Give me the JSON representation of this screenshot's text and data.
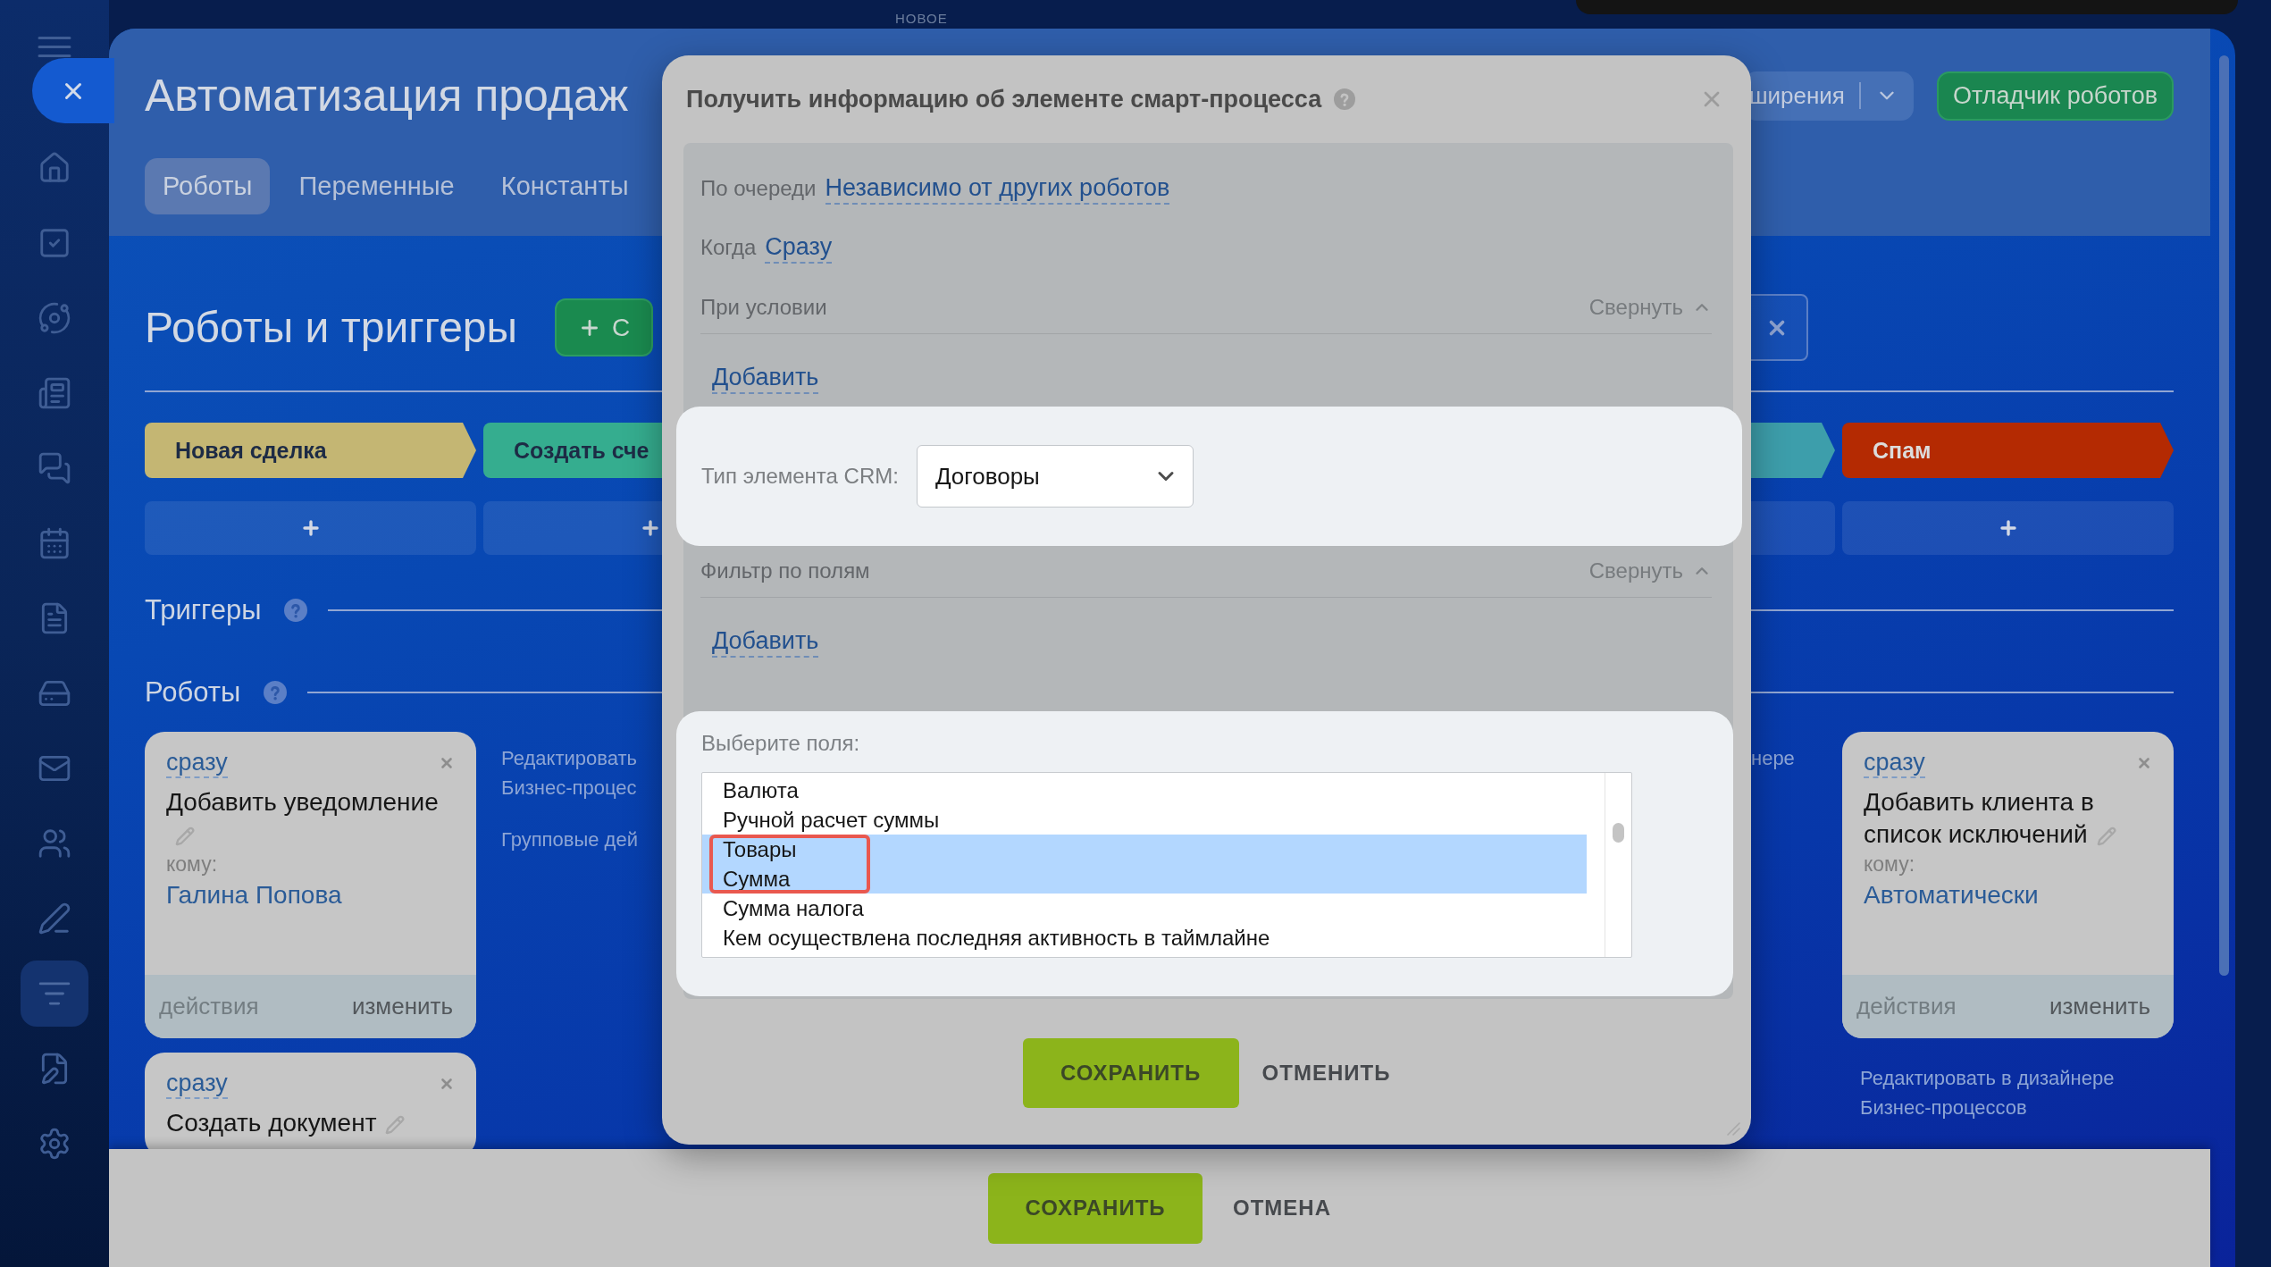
{
  "top_label": "НОВОЕ",
  "sidebar": {
    "items": [
      {
        "kind": "home",
        "selected": false
      },
      {
        "kind": "tasks",
        "selected": false
      },
      {
        "kind": "flow",
        "selected": false
      },
      {
        "kind": "feed",
        "selected": false
      },
      {
        "kind": "chat",
        "selected": false
      },
      {
        "kind": "calendar",
        "selected": false
      },
      {
        "kind": "document",
        "selected": false
      },
      {
        "kind": "drive",
        "selected": false
      },
      {
        "kind": "mail",
        "selected": false
      },
      {
        "kind": "contacts",
        "selected": false
      },
      {
        "kind": "sign",
        "selected": false
      },
      {
        "kind": "funnel",
        "selected": true
      },
      {
        "kind": "esign",
        "selected": false
      },
      {
        "kind": "settings",
        "selected": false
      }
    ]
  },
  "header": {
    "title": "Автоматизация продаж",
    "tabs": [
      {
        "label": "Роботы",
        "selected": true
      },
      {
        "label": "Переменные",
        "selected": false
      },
      {
        "label": "Константы",
        "selected": false
      }
    ],
    "dropdown_button": {
      "label": "ширения"
    },
    "debugger_button": {
      "label": "Отладчик роботов"
    }
  },
  "board": {
    "title": "Роботы и триггеры",
    "create_button": {
      "label": "С"
    },
    "left_columns": [
      {
        "stage": {
          "name": "Новая сделка",
          "color": "#c4b673"
        },
        "robots": [
          {
            "delay": "сразу",
            "title": "Добавить уведомление",
            "recipient_label": "кому:",
            "recipient": "Галина Попова",
            "actions": {
              "label": "действия",
              "disabled": true
            },
            "edit": "изменить"
          },
          {
            "delay": "сразу",
            "title": "Создать документ"
          }
        ]
      },
      {
        "stage": {
          "name": "Создать сче",
          "color": "#35ad8f"
        },
        "links": [
          {
            "lines": [
              "Редактировать",
              "Бизнес-процес"
            ]
          },
          {
            "lines": [
              "Групповые дей"
            ]
          }
        ]
      }
    ],
    "right_columns": [
      {
        "stage": {
          "color": "#3d9eab"
        },
        "links": [
          {
            "lines": [
              "нере"
            ]
          }
        ]
      },
      {
        "stage": {
          "name": "Спам",
          "color": "#b42a02"
        },
        "robots": [
          {
            "delay": "сразу",
            "title": "Добавить клиента в список исключений",
            "recipient_label": "кому:",
            "recipient": "Автоматически",
            "actions": {
              "label": "действия",
              "disabled": true
            },
            "edit": "изменить"
          }
        ],
        "links": [
          {
            "lines": [
              "Редактировать в дизайнере",
              "Бизнес-процессов"
            ]
          }
        ]
      }
    ],
    "triggers_title": "Триггеры",
    "robots_title": "Роботы"
  },
  "dialog": {
    "title": "Получить информацию об элементе смарт-процесса",
    "order": {
      "label": "По очереди",
      "value": "Независимо от других роботов"
    },
    "when": {
      "label": "Когда",
      "value": "Сразу"
    },
    "condition": {
      "title": "При условии",
      "toggle": "Свернуть",
      "expanded": true,
      "add_link": "Добавить"
    },
    "crm_type": {
      "label": "Тип элемента CRM:",
      "value": "Договоры",
      "highlighted": true
    },
    "field_filter": {
      "title": "Фильтр по полям",
      "toggle": "Свернуть",
      "expanded": true,
      "add_link": "Добавить"
    },
    "fields": {
      "label": "Выберите поля:",
      "highlighted": true,
      "callout": true,
      "options": [
        {
          "label": "Валюта",
          "selected": false
        },
        {
          "label": "Ручной расчет суммы",
          "selected": false
        },
        {
          "label": "Товары",
          "selected": true
        },
        {
          "label": "Сумма",
          "selected": true
        },
        {
          "label": "Сумма налога",
          "selected": false
        },
        {
          "label": "Кем осуществлена последняя активность в таймлайне",
          "selected": false
        }
      ]
    },
    "buttons": [
      {
        "label": "СОХРАНИТЬ",
        "kind": "primary"
      },
      {
        "label": "ОТМЕНИТЬ",
        "kind": "link"
      }
    ]
  },
  "footer": {
    "buttons": [
      {
        "label": "СОХРАНИТЬ",
        "kind": "primary"
      },
      {
        "label": "ОТМЕНА",
        "kind": "link"
      }
    ]
  }
}
